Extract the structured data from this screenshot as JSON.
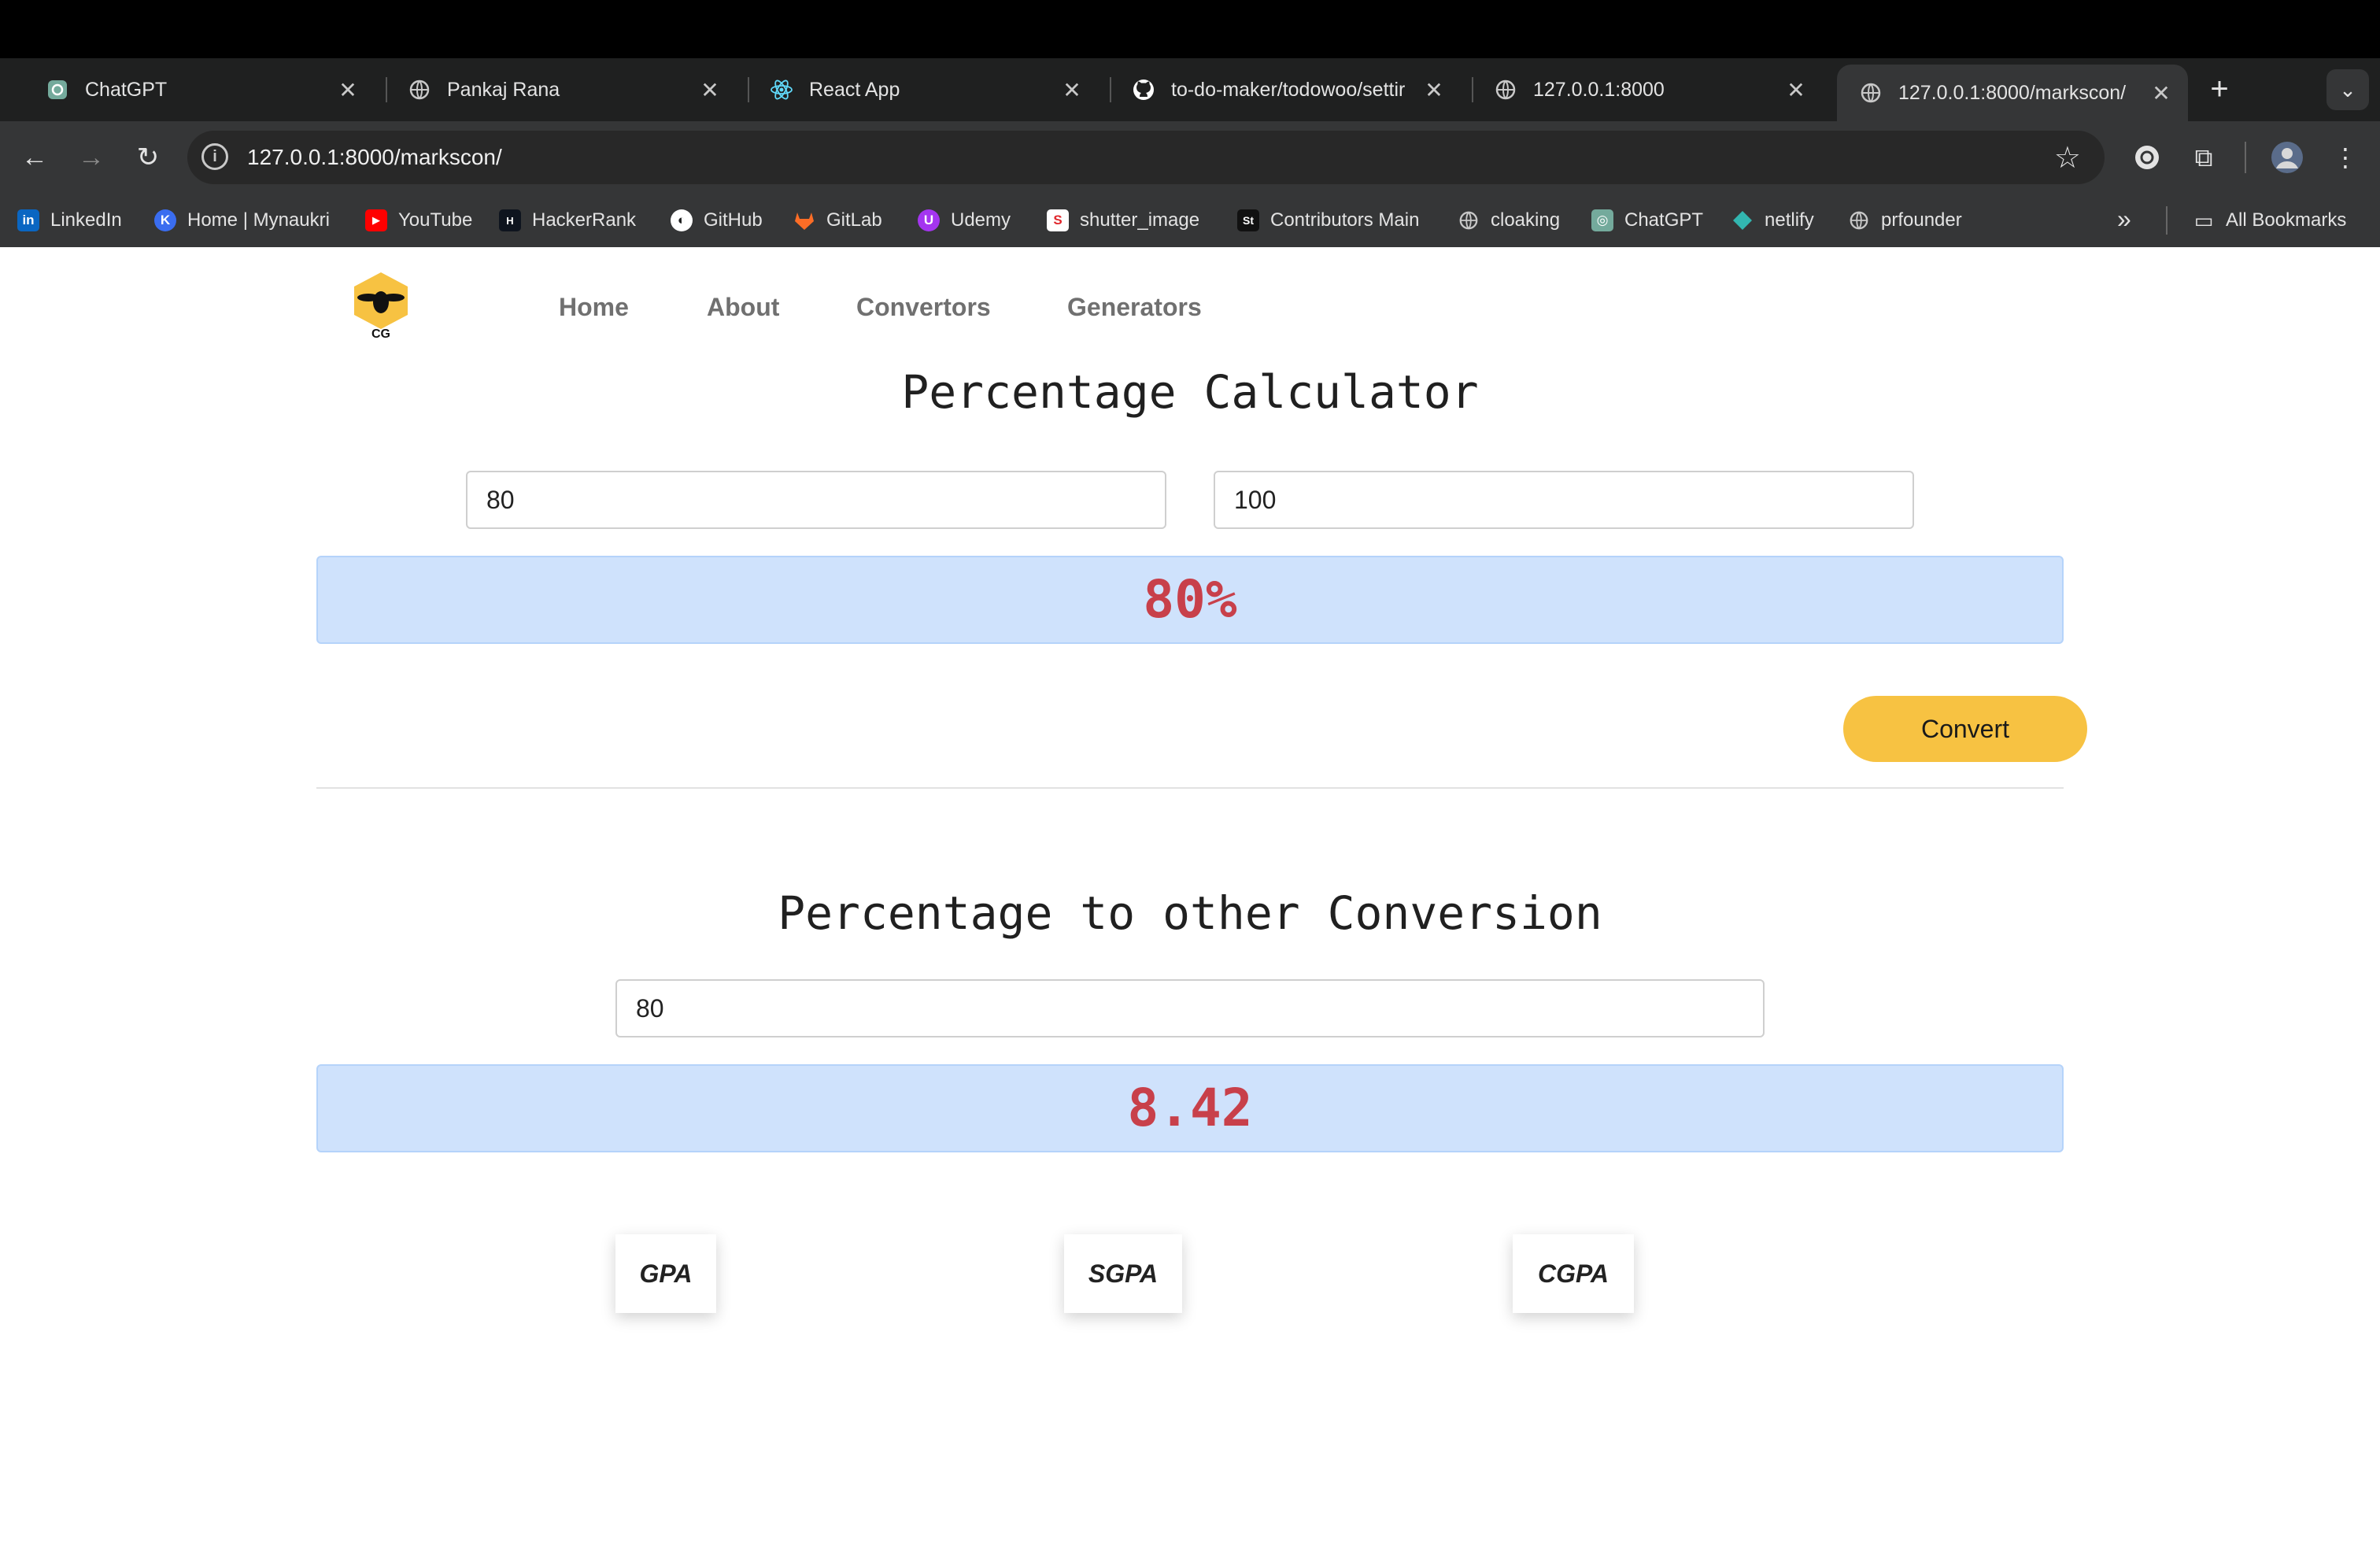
{
  "tabs": [
    {
      "title": "ChatGPT",
      "icon": "chatgpt-icon"
    },
    {
      "title": "Pankaj Rana",
      "icon": "globe-icon"
    },
    {
      "title": "React App",
      "icon": "react-icon"
    },
    {
      "title": "to-do-maker/todowoo/settir",
      "icon": "github-icon"
    },
    {
      "title": "127.0.0.1:8000",
      "icon": "globe-icon"
    },
    {
      "title": "127.0.0.1:8000/markscon/",
      "icon": "globe-icon",
      "active": true
    }
  ],
  "address_bar": {
    "url": "127.0.0.1:8000/markscon/"
  },
  "bookmarks": [
    {
      "label": "LinkedIn",
      "icon": "linkedin-icon"
    },
    {
      "label": "Home | Mynaukri",
      "icon": "mynaukri-icon"
    },
    {
      "label": "YouTube",
      "icon": "youtube-icon"
    },
    {
      "label": "HackerRank",
      "icon": "hackerrank-icon"
    },
    {
      "label": "GitHub",
      "icon": "github-icon"
    },
    {
      "label": "GitLab",
      "icon": "gitlab-icon"
    },
    {
      "label": "Udemy",
      "icon": "udemy-icon"
    },
    {
      "label": "shutter_image",
      "icon": "shutter-icon"
    },
    {
      "label": "Contributors Main",
      "icon": "st-icon"
    },
    {
      "label": "cloaking",
      "icon": "globe-icon"
    },
    {
      "label": "ChatGPT",
      "icon": "chatgpt-icon"
    },
    {
      "label": "netlify",
      "icon": "netlify-icon"
    },
    {
      "label": "prfounder",
      "icon": "globe-icon"
    }
  ],
  "all_bookmarks_label": "All Bookmarks",
  "site": {
    "logo_text": "CG",
    "nav": [
      "Home",
      "About",
      "Convertors",
      "Generators"
    ]
  },
  "calculator": {
    "title": "Percentage Calculator",
    "obtained_value": "80",
    "total_value": "100",
    "result": "80%",
    "convert_label": "Convert"
  },
  "conversion": {
    "title": "Percentage to other Conversion",
    "percentage_value": "80",
    "result": "8.42",
    "options": [
      "GPA",
      "SGPA",
      "CGPA"
    ]
  },
  "colors": {
    "accent": "#f7c242",
    "result_bg": "#cfe2fc",
    "result_text": "#c8404a"
  }
}
